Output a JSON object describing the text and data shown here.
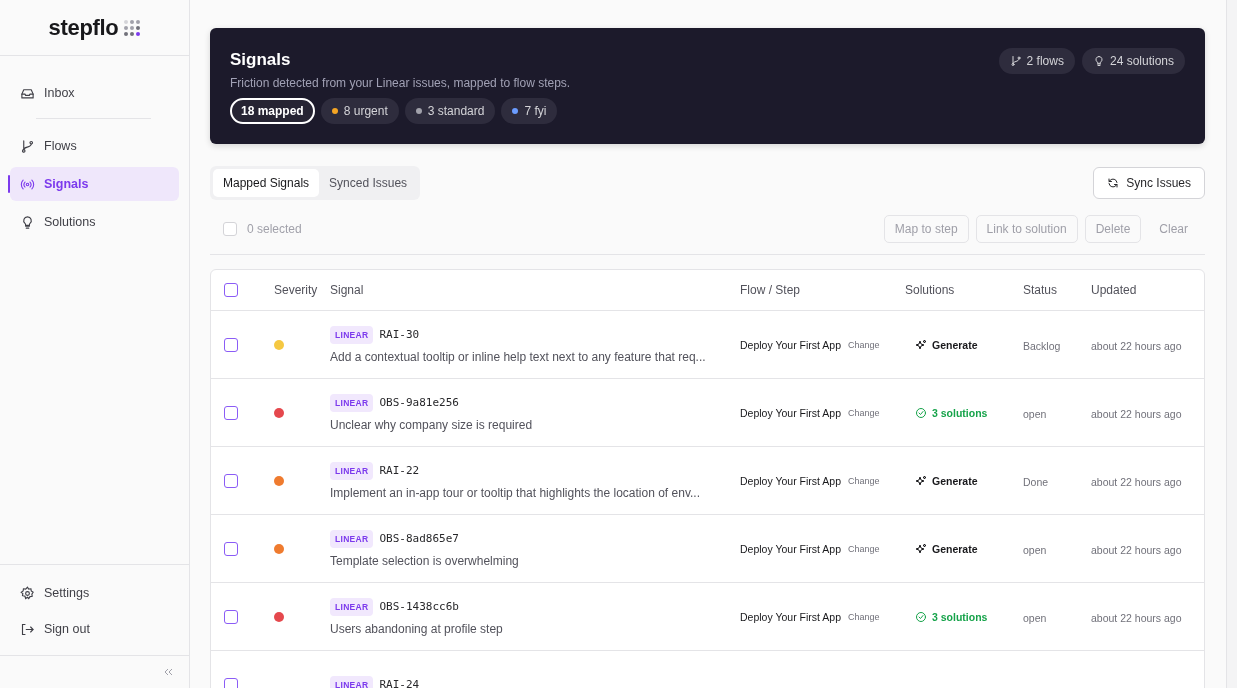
{
  "sidebar": {
    "logo": "stepflo",
    "nav": [
      {
        "label": "Inbox",
        "kind": "inbox",
        "selected": false,
        "divider_after": true
      },
      {
        "label": "Flows",
        "kind": "branch",
        "selected": false
      },
      {
        "label": "Signals",
        "kind": "broadcast",
        "selected": true
      },
      {
        "label": "Solutions",
        "kind": "bulb",
        "selected": false
      }
    ],
    "footer": [
      {
        "label": "Settings",
        "kind": "gear"
      },
      {
        "label": "Sign out",
        "kind": "signout"
      }
    ]
  },
  "header": {
    "title": "Signals",
    "subtitle": "Friction detected from your Linear issues, mapped to flow steps.",
    "filters": [
      {
        "label": "18 mapped",
        "selected": true
      },
      {
        "label": "8 urgent",
        "selected": false,
        "color": "#f5a524"
      },
      {
        "label": "3 standard",
        "selected": false,
        "color": "#a1a1aa"
      },
      {
        "label": "7 fyi",
        "selected": false,
        "color": "#6b9cff"
      }
    ],
    "stats": [
      {
        "label": "2 flows",
        "kind": "branch"
      },
      {
        "label": "24 solutions",
        "kind": "bulb"
      }
    ]
  },
  "tabs": [
    {
      "label": "Mapped Signals",
      "selected": true
    },
    {
      "label": "Synced Issues",
      "selected": false
    }
  ],
  "sync_button": "Sync Issues",
  "selection": {
    "checked": false,
    "count": "0 selected",
    "actions": [
      {
        "label": "Map to step",
        "kind": "outlined",
        "disabled": true
      },
      {
        "label": "Link to solution",
        "kind": "outlined",
        "disabled": true
      },
      {
        "label": "Delete",
        "kind": "outlined",
        "disabled": true
      },
      {
        "label": "Clear",
        "kind": "plain",
        "disabled": true
      }
    ]
  },
  "table": {
    "select_all_checked": false,
    "columns": [
      "Severity",
      "Signal",
      "Flow / Step",
      "Solutions",
      "Status",
      "Updated"
    ],
    "rows": [
      {
        "checked": false,
        "color": "#f5c842",
        "source": "LINEAR",
        "id": "RAI-30",
        "description": "Add a contextual tooltip or inline help text next to any feature that req...",
        "flow": "Deploy Your First App",
        "change": "Change",
        "solution": {
          "kind": "generate",
          "label": "Generate"
        },
        "status": "Backlog",
        "updated": "about 22 hours ago"
      },
      {
        "checked": false,
        "color": "#e5484d",
        "source": "LINEAR",
        "id": "OBS-9a81e256",
        "description": "Unclear why company size is required",
        "flow": "Deploy Your First App",
        "change": "Change",
        "solution": {
          "kind": "linked",
          "label": "3 solutions"
        },
        "status": "open",
        "updated": "about 22 hours ago"
      },
      {
        "checked": false,
        "color": "#ef7b2f",
        "source": "LINEAR",
        "id": "RAI-22",
        "description": "Implement an in-app tour or tooltip that highlights the location of env...",
        "flow": "Deploy Your First App",
        "change": "Change",
        "solution": {
          "kind": "generate",
          "label": "Generate"
        },
        "status": "Done",
        "updated": "about 22 hours ago"
      },
      {
        "checked": false,
        "color": "#ef7b2f",
        "source": "LINEAR",
        "id": "OBS-8ad865e7",
        "description": "Template selection is overwhelming",
        "flow": "Deploy Your First App",
        "change": "Change",
        "solution": {
          "kind": "generate",
          "label": "Generate"
        },
        "status": "open",
        "updated": "about 22 hours ago"
      },
      {
        "checked": false,
        "color": "#e5484d",
        "source": "LINEAR",
        "id": "OBS-1438cc6b",
        "description": "Users abandoning at profile step",
        "flow": "Deploy Your First App",
        "change": "Change",
        "solution": {
          "kind": "linked",
          "label": "3 solutions"
        },
        "status": "open",
        "updated": "about 22 hours ago"
      },
      {
        "checked": false,
        "source": "LINEAR",
        "id": "RAI-24"
      }
    ]
  }
}
